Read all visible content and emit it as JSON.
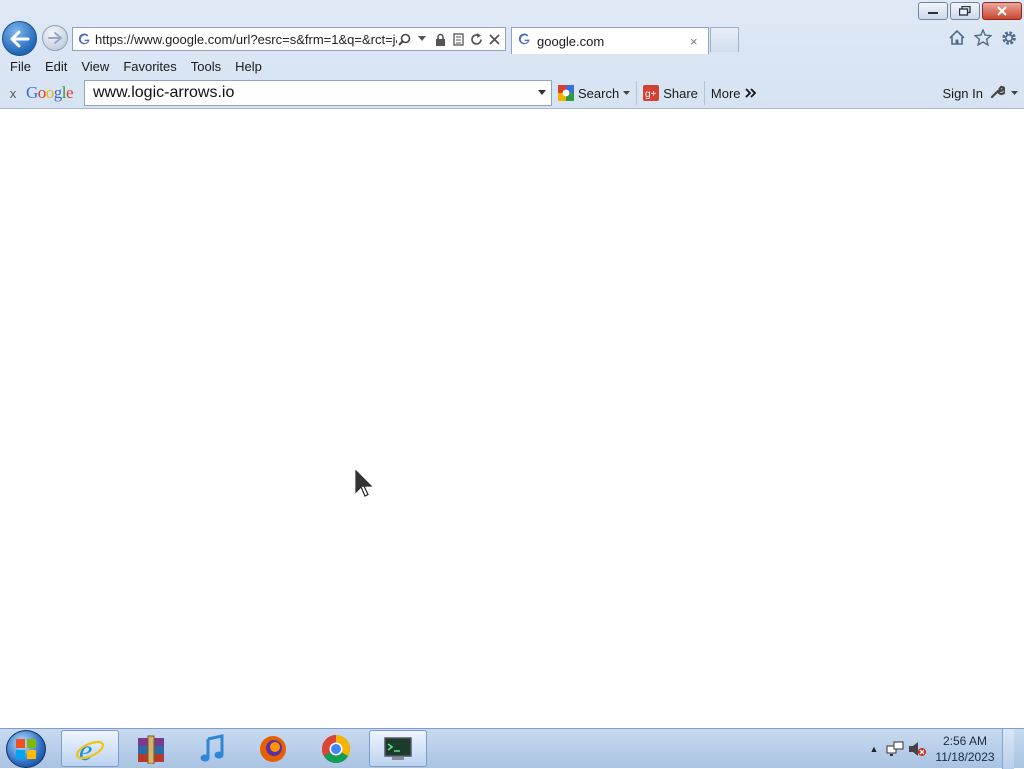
{
  "window": {
    "controls": {
      "minimize": "minimize",
      "restore": "restore",
      "close": "close"
    }
  },
  "nav": {
    "back_icon": "back-arrow-icon",
    "forward_icon": "forward-arrow-icon"
  },
  "addressbar": {
    "url": "https://www.google.com/url?esrc=s&frm=1&q=&rct=j&s",
    "tools": [
      "search-icon",
      "dropdown-icon",
      "lock-icon",
      "compat-view-icon",
      "refresh-icon",
      "stop-icon"
    ]
  },
  "tab": {
    "title": "google.com",
    "close": "×"
  },
  "command_icons": [
    "home-icon",
    "favorites-star-icon",
    "gear-icon"
  ],
  "menubar": {
    "items": [
      "File",
      "Edit",
      "View",
      "Favorites",
      "Tools",
      "Help"
    ]
  },
  "google_toolbar": {
    "close": "x",
    "logo": "Google",
    "search_value": "www.logic-arrows.io",
    "search_label": "Search",
    "share_label": "Share",
    "more_label": "More",
    "signin_label": "Sign In"
  },
  "taskbar": {
    "apps": [
      "internet-explorer-icon",
      "winrar-icon",
      "itunes-icon",
      "firefox-icon",
      "chrome-icon",
      "terminal-app-icon"
    ],
    "clock": {
      "time": "2:56 AM",
      "date": "11/18/2023"
    }
  },
  "colors": {
    "chrome_bg": "#d6e3f2",
    "taskbar_bg": "#a9c3e3",
    "accent": "#2268b8"
  }
}
